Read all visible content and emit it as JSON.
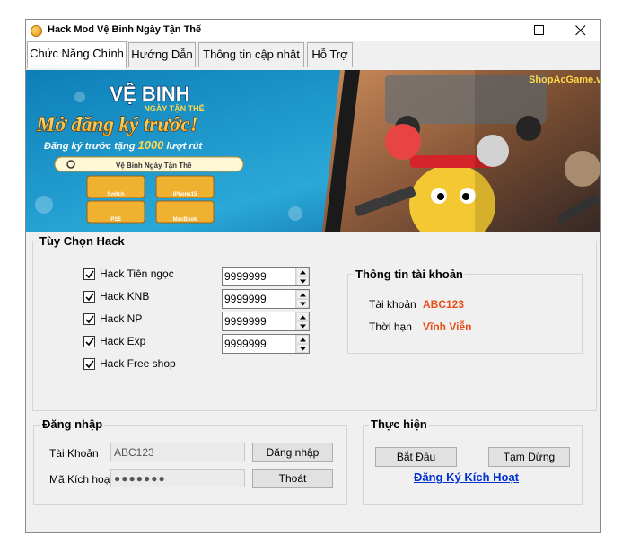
{
  "window": {
    "title": "Hack Mod Vệ Binh Ngày Tận Thế",
    "icons": {
      "app": "coin-icon",
      "minimize": "minimize-icon",
      "maximize": "maximize-icon",
      "close": "close-icon"
    }
  },
  "tabs": [
    {
      "label": "Chức Năng Chính",
      "active": true
    },
    {
      "label": "Hướng Dẫn",
      "active": false
    },
    {
      "label": "Thông tin cập nhật",
      "active": false
    },
    {
      "label": "Hỗ Trợ",
      "active": false
    }
  ],
  "banner": {
    "logo_title": "VỆ BINH",
    "logo_subtitle": "NGÀY TẬN THẾ",
    "headline": "Mở đăng ký trước!",
    "subline_prefix": "Đăng ký trước tặng ",
    "subline_number": "1000",
    "subline_suffix": " lượt rút",
    "search_text": "Vệ Binh Ngày Tận Thế",
    "prizes": [
      "Switch",
      "iPhone15",
      "PS5",
      "MacBook"
    ],
    "watermark": "ShopAcGame.vn"
  },
  "hack_options": {
    "title": "Tùy Chọn Hack",
    "items": [
      {
        "label": "Hack Tiên ngọc",
        "checked": true,
        "value": "9999999"
      },
      {
        "label": "Hack KNB",
        "checked": true,
        "value": "9999999"
      },
      {
        "label": "Hack NP",
        "checked": true,
        "value": "9999999"
      },
      {
        "label": "Hack Exp",
        "checked": true,
        "value": "9999999"
      },
      {
        "label": "Hack Free shop",
        "checked": true
      }
    ]
  },
  "account_info": {
    "title": "Thông tin tài khoản",
    "account_label": "Tài khoản",
    "account_value": "ABC123",
    "duration_label": "Thời hạn",
    "duration_value": "Vĩnh Viễn",
    "value_color": "#e8501a"
  },
  "login": {
    "title": "Đăng nhập",
    "account_label": "Tài Khoản",
    "account_value": "ABC123",
    "code_label": "Mã Kích hoạt",
    "code_value": "●●●●●●●",
    "login_button": "Đăng nhập",
    "exit_button": "Thoát"
  },
  "execute": {
    "title": "Thực hiện",
    "start_button": "Bắt Đầu",
    "pause_button": "Tạm Dừng",
    "register_link": "Đăng Ký Kích Hoạt",
    "link_color": "#0030d0"
  }
}
